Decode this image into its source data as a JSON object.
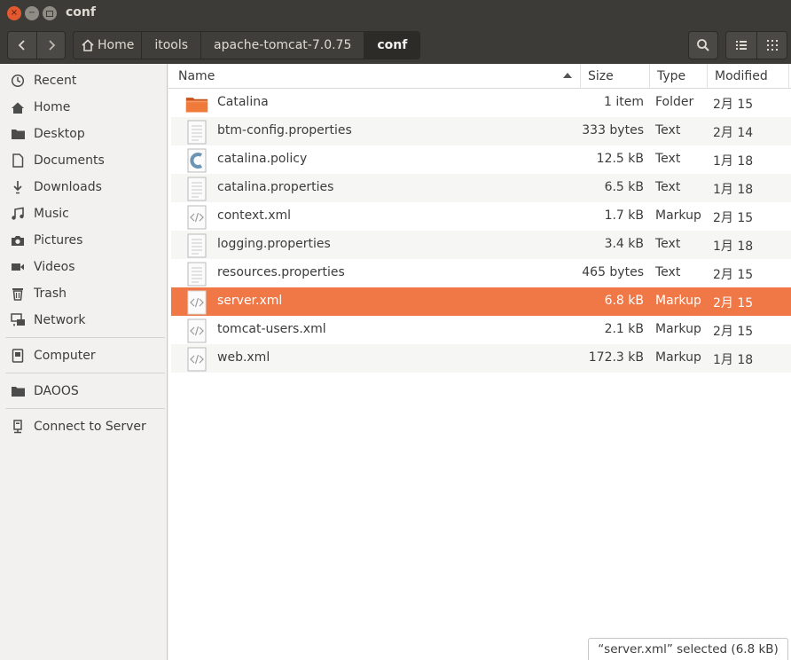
{
  "window": {
    "title": "conf",
    "close_glyph": "×",
    "min_glyph": "−"
  },
  "header": {
    "back_glyph": "‹",
    "forward_glyph": "›",
    "breadcrumbs": [
      "Home",
      "itools",
      "apache-tomcat-7.0.75",
      "conf"
    ],
    "home_icon": "home-icon",
    "search_icon": "search-icon",
    "list_view_icon": "list-view-icon",
    "grid_view_icon": "grid-view-icon"
  },
  "sidebar": {
    "items": [
      {
        "label": "Recent",
        "icon": "clock-icon"
      },
      {
        "label": "Home",
        "icon": "home-icon"
      },
      {
        "label": "Desktop",
        "icon": "folder-icon"
      },
      {
        "label": "Documents",
        "icon": "document-icon"
      },
      {
        "label": "Downloads",
        "icon": "download-icon"
      },
      {
        "label": "Music",
        "icon": "music-icon"
      },
      {
        "label": "Pictures",
        "icon": "camera-icon"
      },
      {
        "label": "Videos",
        "icon": "video-icon"
      },
      {
        "label": "Trash",
        "icon": "trash-icon"
      },
      {
        "label": "Network",
        "icon": "network-icon"
      },
      {
        "label": "Computer",
        "icon": "computer-icon"
      },
      {
        "label": "DAOOS",
        "icon": "folder-icon"
      },
      {
        "label": "Connect to Server",
        "icon": "server-icon"
      }
    ]
  },
  "columns": {
    "name": "Name",
    "size": "Size",
    "type": "Type",
    "modified": "Modified"
  },
  "files": [
    {
      "name": "Catalina",
      "size": "1 item",
      "type": "Folder",
      "modified": "2月 15",
      "icon": "folder-icon"
    },
    {
      "name": "btm-config.properties",
      "size": "333 bytes",
      "type": "Text",
      "modified": "2月 14",
      "icon": "text-file-icon"
    },
    {
      "name": "catalina.policy",
      "size": "12.5 kB",
      "type": "Text",
      "modified": "1月 18",
      "icon": "c-source-icon"
    },
    {
      "name": "catalina.properties",
      "size": "6.5 kB",
      "type": "Text",
      "modified": "1月 18",
      "icon": "text-file-icon"
    },
    {
      "name": "context.xml",
      "size": "1.7 kB",
      "type": "Markup",
      "modified": "2月 15",
      "icon": "markup-file-icon"
    },
    {
      "name": "logging.properties",
      "size": "3.4 kB",
      "type": "Text",
      "modified": "1月 18",
      "icon": "text-file-icon"
    },
    {
      "name": "resources.properties",
      "size": "465 bytes",
      "type": "Text",
      "modified": "2月 15",
      "icon": "text-file-icon"
    },
    {
      "name": "server.xml",
      "size": "6.8 kB",
      "type": "Markup",
      "modified": "2月 15",
      "icon": "markup-file-icon",
      "selected": true
    },
    {
      "name": "tomcat-users.xml",
      "size": "2.1 kB",
      "type": "Markup",
      "modified": "2月 15",
      "icon": "markup-file-icon"
    },
    {
      "name": "web.xml",
      "size": "172.3 kB",
      "type": "Markup",
      "modified": "1月 18",
      "icon": "markup-file-icon"
    }
  ],
  "status": "“server.xml” selected  (6.8 kB)",
  "colors": {
    "selection": "#f07746",
    "titlebar": "#3c3b37",
    "folder": "#e8702f"
  }
}
